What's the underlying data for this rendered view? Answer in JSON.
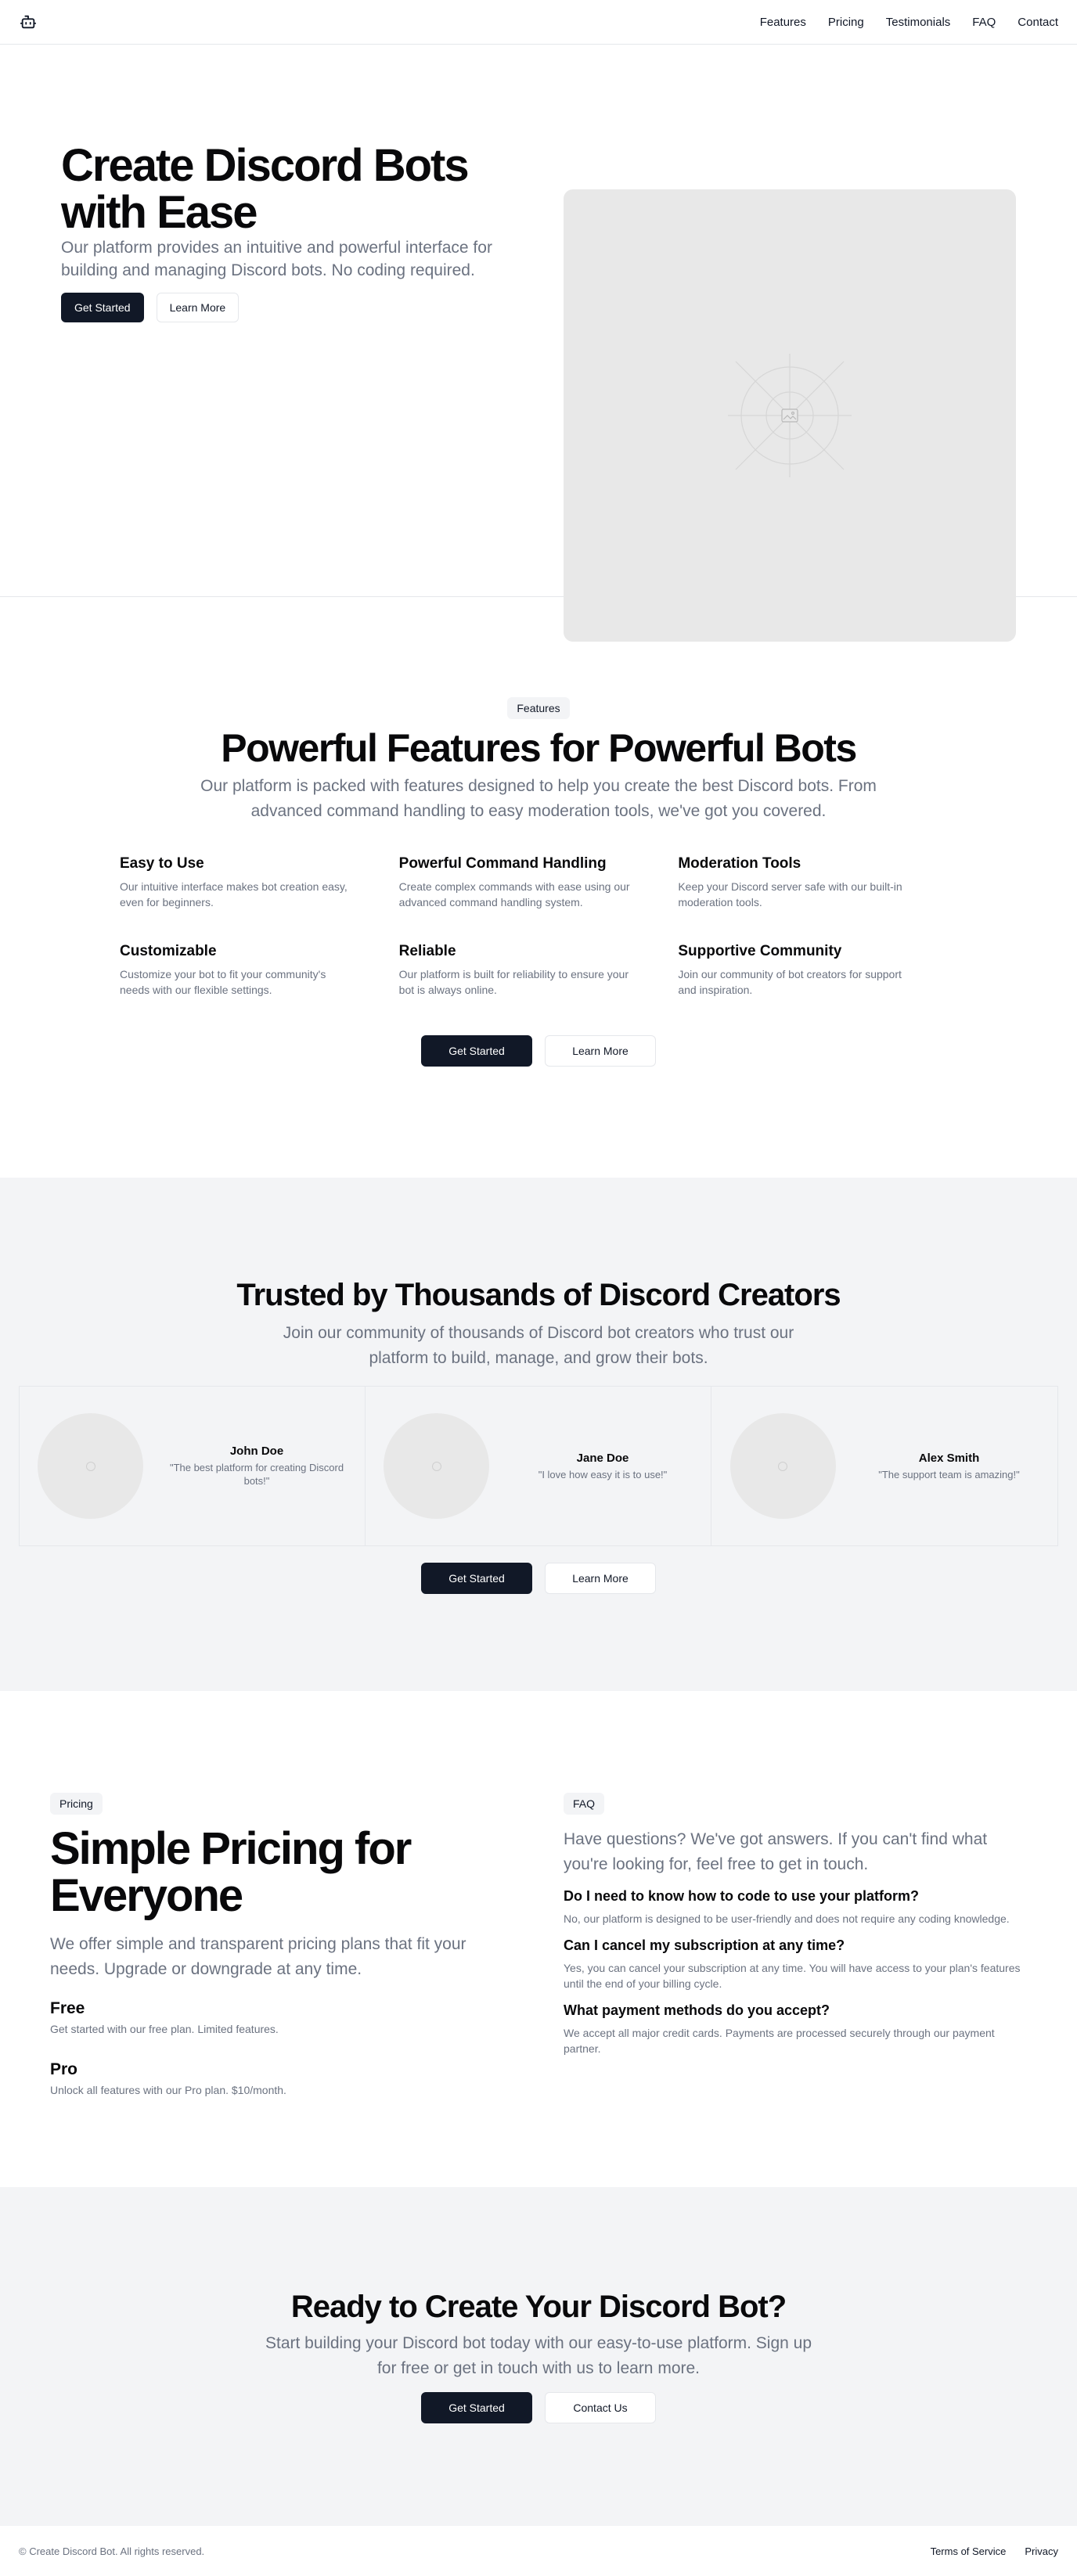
{
  "header": {
    "logo_icon": "bot-icon",
    "nav": [
      "Features",
      "Pricing",
      "Testimonials",
      "FAQ",
      "Contact"
    ]
  },
  "hero": {
    "title": "Create Discord Bots with Ease",
    "subtitle": "Our platform provides an intuitive and powerful interface for building and managing Discord bots. No coding required.",
    "primary_button": "Get Started",
    "secondary_button": "Learn More",
    "image_icon": "image-placeholder-icon"
  },
  "features": {
    "badge": "Features",
    "title": "Powerful Features for Powerful Bots",
    "subtitle": "Our platform is packed with features designed to help you create the best Discord bots. From advanced command handling to easy moderation tools, we've got you covered.",
    "items": [
      {
        "title": "Easy to Use",
        "desc": "Our intuitive interface makes bot creation easy, even for beginners."
      },
      {
        "title": "Powerful Command Handling",
        "desc": "Create complex commands with ease using our advanced command handling system."
      },
      {
        "title": "Moderation Tools",
        "desc": "Keep your Discord server safe with our built-in moderation tools."
      },
      {
        "title": "Customizable",
        "desc": "Customize your bot to fit your community's needs with our flexible settings."
      },
      {
        "title": "Reliable",
        "desc": "Our platform is built for reliability to ensure your bot is always online."
      },
      {
        "title": "Supportive Community",
        "desc": "Join our community of bot creators for support and inspiration."
      }
    ],
    "primary_button": "Get Started",
    "secondary_button": "Learn More"
  },
  "testimonials": {
    "title": "Trusted by Thousands of Discord Creators",
    "subtitle": "Join our community of thousands of Discord bot creators who trust our platform to build, manage, and grow their bots.",
    "items": [
      {
        "name": "John Doe",
        "quote": "\"The best platform for creating Discord bots!\""
      },
      {
        "name": "Jane Doe",
        "quote": "\"I love how easy it is to use!\""
      },
      {
        "name": "Alex Smith",
        "quote": "\"The support team is amazing!\""
      }
    ],
    "primary_button": "Get Started",
    "secondary_button": "Learn More"
  },
  "pricing": {
    "badge": "Pricing",
    "title": "Simple Pricing for Everyone",
    "subtitle": "We offer simple and transparent pricing plans that fit your needs. Upgrade or downgrade at any time.",
    "plans": [
      {
        "title": "Free",
        "desc": "Get started with our free plan. Limited features."
      },
      {
        "title": "Pro",
        "desc": "Unlock all features with our Pro plan. $10/month."
      }
    ]
  },
  "faq": {
    "badge": "FAQ",
    "subtitle": "Have questions? We've got answers. If you can't find what you're looking for, feel free to get in touch.",
    "items": [
      {
        "q": "Do I need to know how to code to use your platform?",
        "a": "No, our platform is designed to be user-friendly and does not require any coding knowledge."
      },
      {
        "q": "Can I cancel my subscription at any time?",
        "a": "Yes, you can cancel your subscription at any time. You will have access to your plan's features until the end of your billing cycle."
      },
      {
        "q": "What payment methods do you accept?",
        "a": "We accept all major credit cards. Payments are processed securely through our payment partner."
      }
    ]
  },
  "cta": {
    "title": "Ready to Create Your Discord Bot?",
    "subtitle": "Start building your Discord bot today with our easy-to-use platform. Sign up for free or get in touch with us to learn more.",
    "primary_button": "Get Started",
    "secondary_button": "Contact Us"
  },
  "footer": {
    "copyright": "© Create Discord Bot. All rights reserved.",
    "links": [
      "Terms of Service",
      "Privacy"
    ]
  },
  "colors": {
    "primary": "#111827",
    "muted_text": "#6b7280",
    "section_bg": "#f3f4f6",
    "placeholder_bg": "#e8e8e8"
  }
}
